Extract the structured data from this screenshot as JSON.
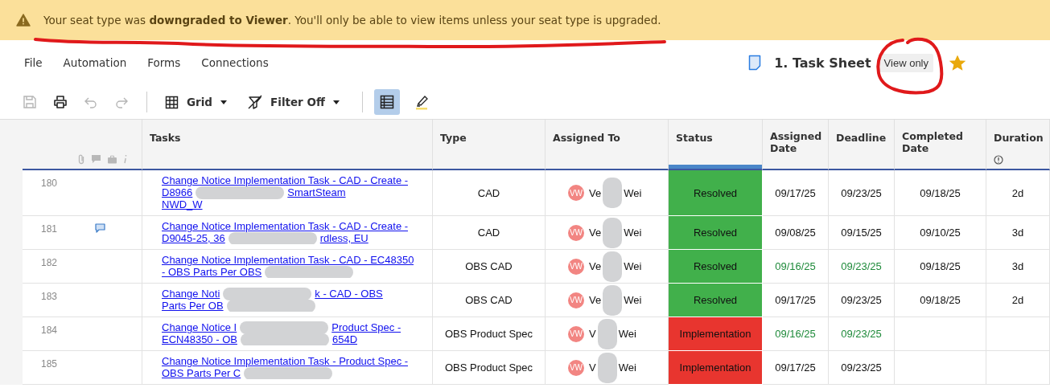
{
  "banner": {
    "message": "Your seat type was **downgraded to Viewer**. You'll only be able to view items unless your seat type is upgraded."
  },
  "menu": [
    "File",
    "Automation",
    "Forms",
    "Connections"
  ],
  "sheet": {
    "title": "1. Task Sheet",
    "badge": "View only",
    "favorite": true
  },
  "toolbar": {
    "view": "Grid",
    "filter": "Filter Off",
    "grid_view_selected": true
  },
  "table": {
    "columns": [
      "Tasks",
      "Type",
      "Assigned To",
      "Status",
      "Assigned Date",
      "Deadline",
      "Completed Date",
      "Duration"
    ],
    "rows": [
      {
        "number": "180",
        "has_comment": false,
        "task": [
          [
            {
              "kind": "text",
              "text": "Change Notice Implementation Task - CAD - Create -"
            }
          ],
          [
            {
              "kind": "text",
              "text": "D8966"
            },
            {
              "kind": "redacted"
            },
            {
              "kind": "text",
              "text": "SmartSteam"
            }
          ],
          [
            {
              "kind": "text",
              "text": "NWD_W"
            }
          ]
        ],
        "type": "CAD",
        "initials": "VW",
        "assignee": [
          {
            "kind": "text",
            "text": "Ve"
          },
          {
            "kind": "redacted"
          },
          {
            "kind": "text",
            "text": "Wei"
          }
        ],
        "status": {
          "text": "Resolved",
          "color": "#41b04b"
        },
        "assigned_date": {
          "text": "09/17/25"
        },
        "deadline": {
          "text": "09/23/25"
        },
        "completed_date": "09/18/25",
        "duration": "2d"
      },
      {
        "number": "181",
        "has_comment": true,
        "task": [
          [
            {
              "kind": "text",
              "text": "Change Notice Implementation Task - CAD - Create -"
            }
          ],
          [
            {
              "kind": "text",
              "text": "D9045-25, 36"
            },
            {
              "kind": "redacted"
            },
            {
              "kind": "text",
              "text": "rdless, EU"
            }
          ]
        ],
        "type": "CAD",
        "initials": "VW",
        "assignee": [
          {
            "kind": "text",
            "text": "Ve"
          },
          {
            "kind": "redacted"
          },
          {
            "kind": "text",
            "text": "Wei"
          }
        ],
        "status": {
          "text": "Resolved",
          "color": "#41b04b"
        },
        "assigned_date": {
          "text": "09/08/25"
        },
        "deadline": {
          "text": "09/15/25"
        },
        "completed_date": "09/10/25",
        "duration": "3d"
      },
      {
        "number": "182",
        "has_comment": false,
        "task": [
          [
            {
              "kind": "text",
              "text": "Change Notice Implementation Task - CAD - EC48350"
            }
          ],
          [
            {
              "kind": "text",
              "text": "- OBS Parts Per OBS"
            },
            {
              "kind": "redacted"
            }
          ]
        ],
        "type": "OBS CAD",
        "initials": "VW",
        "assignee": [
          {
            "kind": "text",
            "text": "Ve"
          },
          {
            "kind": "redacted"
          },
          {
            "kind": "text",
            "text": "Wei"
          }
        ],
        "status": {
          "text": "Resolved",
          "color": "#41b04b"
        },
        "assigned_date": {
          "text": "09/16/25",
          "color": "#1e8a3a"
        },
        "deadline": {
          "text": "09/23/25",
          "color": "#1e8a3a"
        },
        "completed_date": "09/18/25",
        "duration": "3d"
      },
      {
        "number": "183",
        "has_comment": false,
        "task": [
          [
            {
              "kind": "text",
              "text": "Change Noti"
            },
            {
              "kind": "redacted"
            },
            {
              "kind": "text",
              "text": "k - CAD - OBS"
            }
          ],
          [
            {
              "kind": "text",
              "text": "Parts Per OB"
            },
            {
              "kind": "redacted"
            }
          ]
        ],
        "type": "OBS CAD",
        "initials": "VW",
        "assignee": [
          {
            "kind": "text",
            "text": "Ve"
          },
          {
            "kind": "redacted"
          },
          {
            "kind": "text",
            "text": "Wei"
          }
        ],
        "status": {
          "text": "Resolved",
          "color": "#41b04b"
        },
        "assigned_date": {
          "text": "09/17/25"
        },
        "deadline": {
          "text": "09/23/25"
        },
        "completed_date": "09/18/25",
        "duration": "2d"
      },
      {
        "number": "184",
        "has_comment": false,
        "task": [
          [
            {
              "kind": "text",
              "text": "Change Notice I"
            },
            {
              "kind": "redacted"
            },
            {
              "kind": "text",
              "text": "Product Spec -"
            }
          ],
          [
            {
              "kind": "text",
              "text": "ECN48350 - OB"
            },
            {
              "kind": "redacted"
            },
            {
              "kind": "text",
              "text": "654D"
            }
          ]
        ],
        "type": "OBS Product Spec",
        "initials": "VW",
        "assignee": [
          {
            "kind": "text",
            "text": "V"
          },
          {
            "kind": "redacted"
          },
          {
            "kind": "text",
            "text": "Wei"
          }
        ],
        "status": {
          "text": "Implementation",
          "color": "#e8352f"
        },
        "assigned_date": {
          "text": "09/16/25",
          "color": "#1e8a3a"
        },
        "deadline": {
          "text": "09/23/25",
          "color": "#1e8a3a"
        }
      },
      {
        "number": "185",
        "has_comment": false,
        "task": [
          [
            {
              "kind": "text",
              "text": "Change Notice Implementation Task - Product Spec -"
            }
          ],
          [
            {
              "kind": "text",
              "text": "OBS Parts Per C"
            },
            {
              "kind": "redacted"
            }
          ]
        ],
        "type": "OBS Product Spec",
        "initials": "VW",
        "assignee": [
          {
            "kind": "text",
            "text": "V"
          },
          {
            "kind": "redacted"
          },
          {
            "kind": "text",
            "text": "Wei"
          }
        ],
        "status": {
          "text": "Implementation",
          "color": "#e8352f"
        },
        "assigned_date": {
          "text": "09/17/25"
        },
        "deadline": {
          "text": "09/23/25"
        }
      }
    ]
  }
}
